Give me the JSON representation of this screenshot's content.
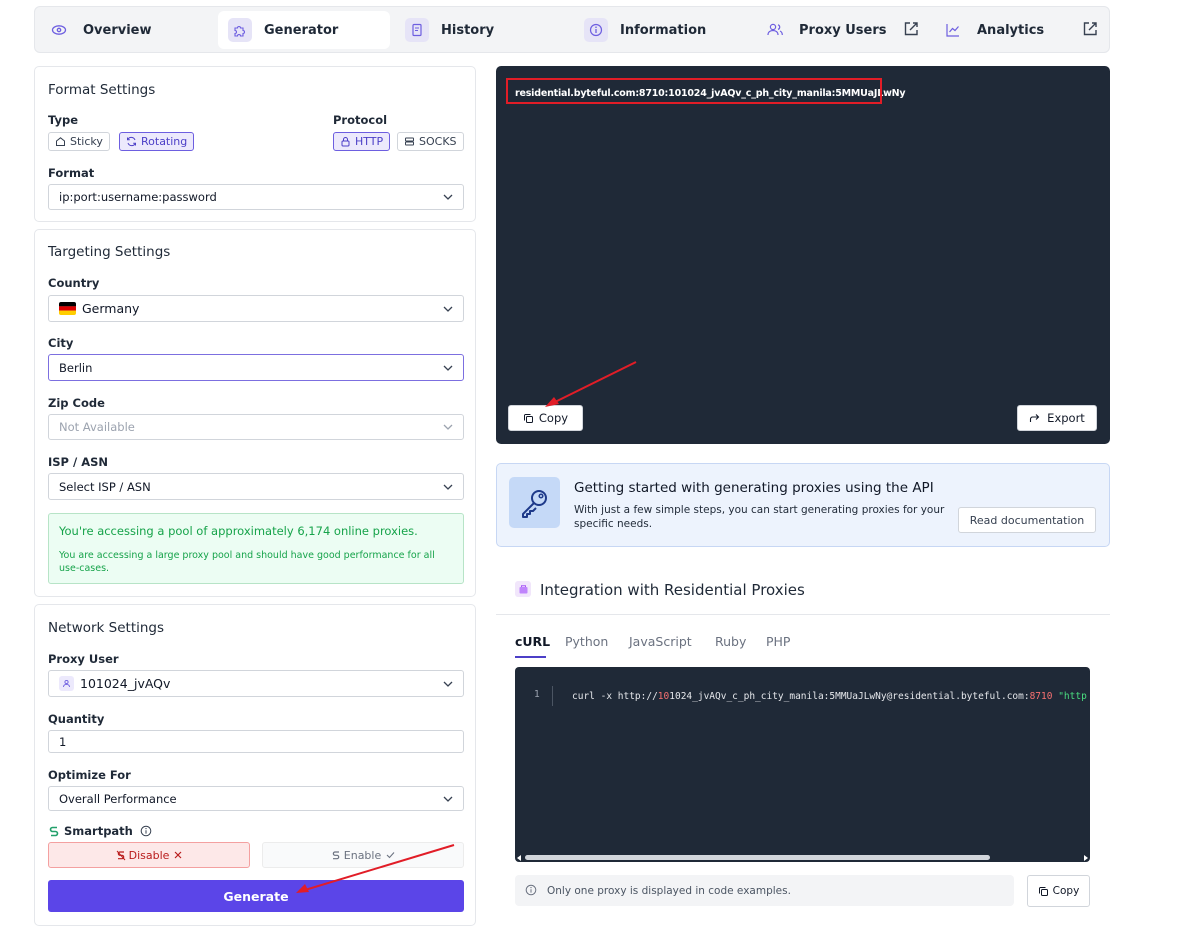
{
  "nav": {
    "tabs": [
      {
        "label": "Overview",
        "icon": "eye-icon"
      },
      {
        "label": "Generator",
        "icon": "puzzle-icon",
        "active": true
      },
      {
        "label": "History",
        "icon": "document-icon"
      },
      {
        "label": "Information",
        "icon": "info-icon"
      },
      {
        "label": "Proxy Users",
        "icon": "users-icon"
      },
      {
        "label": "Analytics",
        "icon": "chart-icon"
      }
    ],
    "external_icon": "external-link-icon",
    "accent": "#5b45e8"
  },
  "format": {
    "title": "Format Settings",
    "type_label": "Type",
    "type_options": [
      "Sticky",
      "Rotating"
    ],
    "type_selected": "Rotating",
    "protocol_label": "Protocol",
    "protocol_options": [
      "HTTP",
      "SOCKS"
    ],
    "protocol_selected": "HTTP",
    "format_label": "Format",
    "format_value": "ip:port:username:password"
  },
  "targeting": {
    "title": "Targeting Settings",
    "country_label": "Country",
    "country_value": "Germany",
    "city_label": "City",
    "city_value": "Berlin",
    "zip_label": "Zip Code",
    "zip_value": "Not Available",
    "isp_label": "ISP / ASN",
    "isp_value": "Select ISP / ASN",
    "pool_line1": "You're accessing a pool of approximately 6,174 online proxies.",
    "pool_line2": "You are accessing a large proxy pool and should have good performance for all use-cases."
  },
  "network": {
    "title": "Network Settings",
    "proxy_user_label": "Proxy User",
    "proxy_user_value": "101024_jvAQv",
    "quantity_label": "Quantity",
    "quantity_value": "1",
    "optimize_label": "Optimize For",
    "optimize_value": "Overall Performance",
    "smartpath_label": "Smartpath",
    "disable_label": "Disable",
    "enable_label": "Enable",
    "generate_label": "Generate"
  },
  "output": {
    "proxy_line": "residential.byteful.com:8710:101024_jvAQv_c_ph_city_manila:5MMUaJLwNy",
    "copy_label": "Copy",
    "export_label": "Export"
  },
  "api": {
    "title": "Getting started with generating proxies using the API",
    "subtitle": "With just a few simple steps, you can start generating proxies for your specific needs.",
    "button": "Read documentation"
  },
  "integration": {
    "title": "Integration with Residential Proxies",
    "languages": [
      "cURL",
      "Python",
      "JavaScript",
      "Ruby",
      "PHP"
    ],
    "active_language": "cURL",
    "line_number": "1",
    "code_cmd": "curl -x http://",
    "code_user_num": "10",
    "code_rest": "1024_jvAQv_c_ph_city_manila:5MMUaJLwNy@residential.byteful.com:",
    "code_port": "8710",
    "code_url": " \"http",
    "note": "Only one proxy is displayed in code examples.",
    "copy_label": "Copy"
  }
}
